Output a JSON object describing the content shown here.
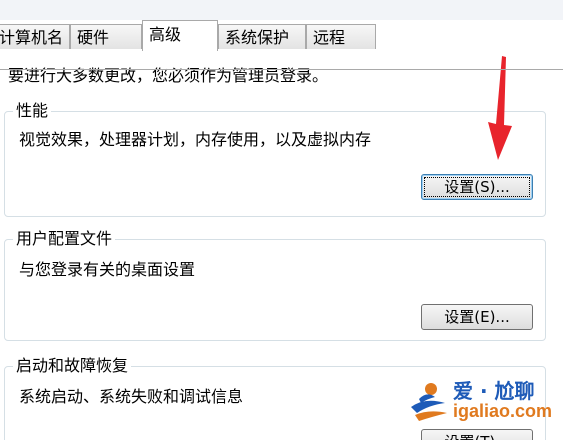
{
  "tabs": [
    {
      "label": "计算机名",
      "active": false
    },
    {
      "label": "硬件",
      "active": false
    },
    {
      "label": "高级",
      "active": true
    },
    {
      "label": "系统保护",
      "active": false
    },
    {
      "label": "远程",
      "active": false
    }
  ],
  "intro_text": "要进行大多数更改，您必须作为管理员登录。",
  "performance": {
    "title": "性能",
    "description": "视觉效果，处理器计划，内存使用，以及虚拟内存",
    "button_label": "设置(S)..."
  },
  "user_profiles": {
    "title": "用户配置文件",
    "description": "与您登录有关的桌面设置",
    "button_label": "设置(E)..."
  },
  "startup_recovery": {
    "title": "启动和故障恢复",
    "description": "系统启动、系统失败和调试信息",
    "button_label": "设置(T)..."
  },
  "watermark": {
    "brand": "爱 · 尬聊",
    "url": "igaliao.com"
  },
  "colors": {
    "arrow": "#e8242c",
    "watermark_blue": "#1e5bb8",
    "watermark_orange": "#e07a1f"
  }
}
